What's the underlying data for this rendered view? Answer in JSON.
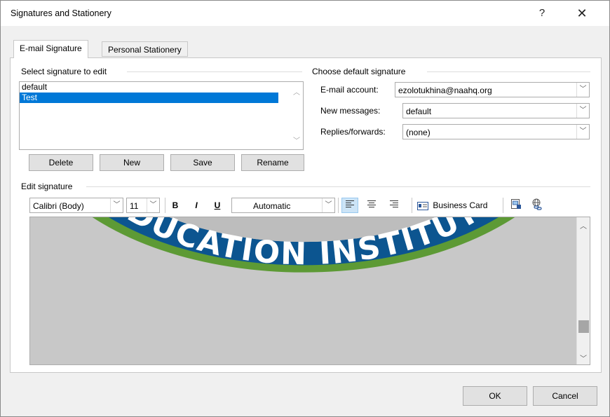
{
  "window": {
    "title": "Signatures and Stationery",
    "help_glyph": "?",
    "close_glyph": "✕"
  },
  "tabs": [
    {
      "label": "E-mail Signature",
      "active": true
    },
    {
      "label": "Personal Stationery",
      "active": false
    }
  ],
  "select_group": {
    "label": "Select signature to edit",
    "items": [
      "default",
      "Test"
    ],
    "selected_index": 1,
    "buttons": {
      "delete": "Delete",
      "new": "New",
      "save": "Save",
      "rename": "Rename"
    }
  },
  "default_group": {
    "label": "Choose default signature",
    "email_account_label": "E-mail account:",
    "email_account_value": "ezolotukhina@naahq.org",
    "new_messages_label": "New messages:",
    "new_messages_value": "default",
    "replies_label": "Replies/forwards:",
    "replies_value": "(none)"
  },
  "edit_group": {
    "label": "Edit signature",
    "font": "Calibri (Body)",
    "size": "11",
    "bold": "B",
    "italic": "I",
    "underline": "U",
    "color": "Automatic",
    "business_card": "Business Card",
    "logo_text": "EDUCATION INSTITUTE",
    "scroll_position": 0.85
  },
  "footer": {
    "ok": "OK",
    "cancel": "Cancel"
  },
  "colors": {
    "selection": "#0078d7",
    "logo_blue": "#0c5590",
    "logo_green": "#5d9a35",
    "editor_gray": "#c8c8c8"
  }
}
